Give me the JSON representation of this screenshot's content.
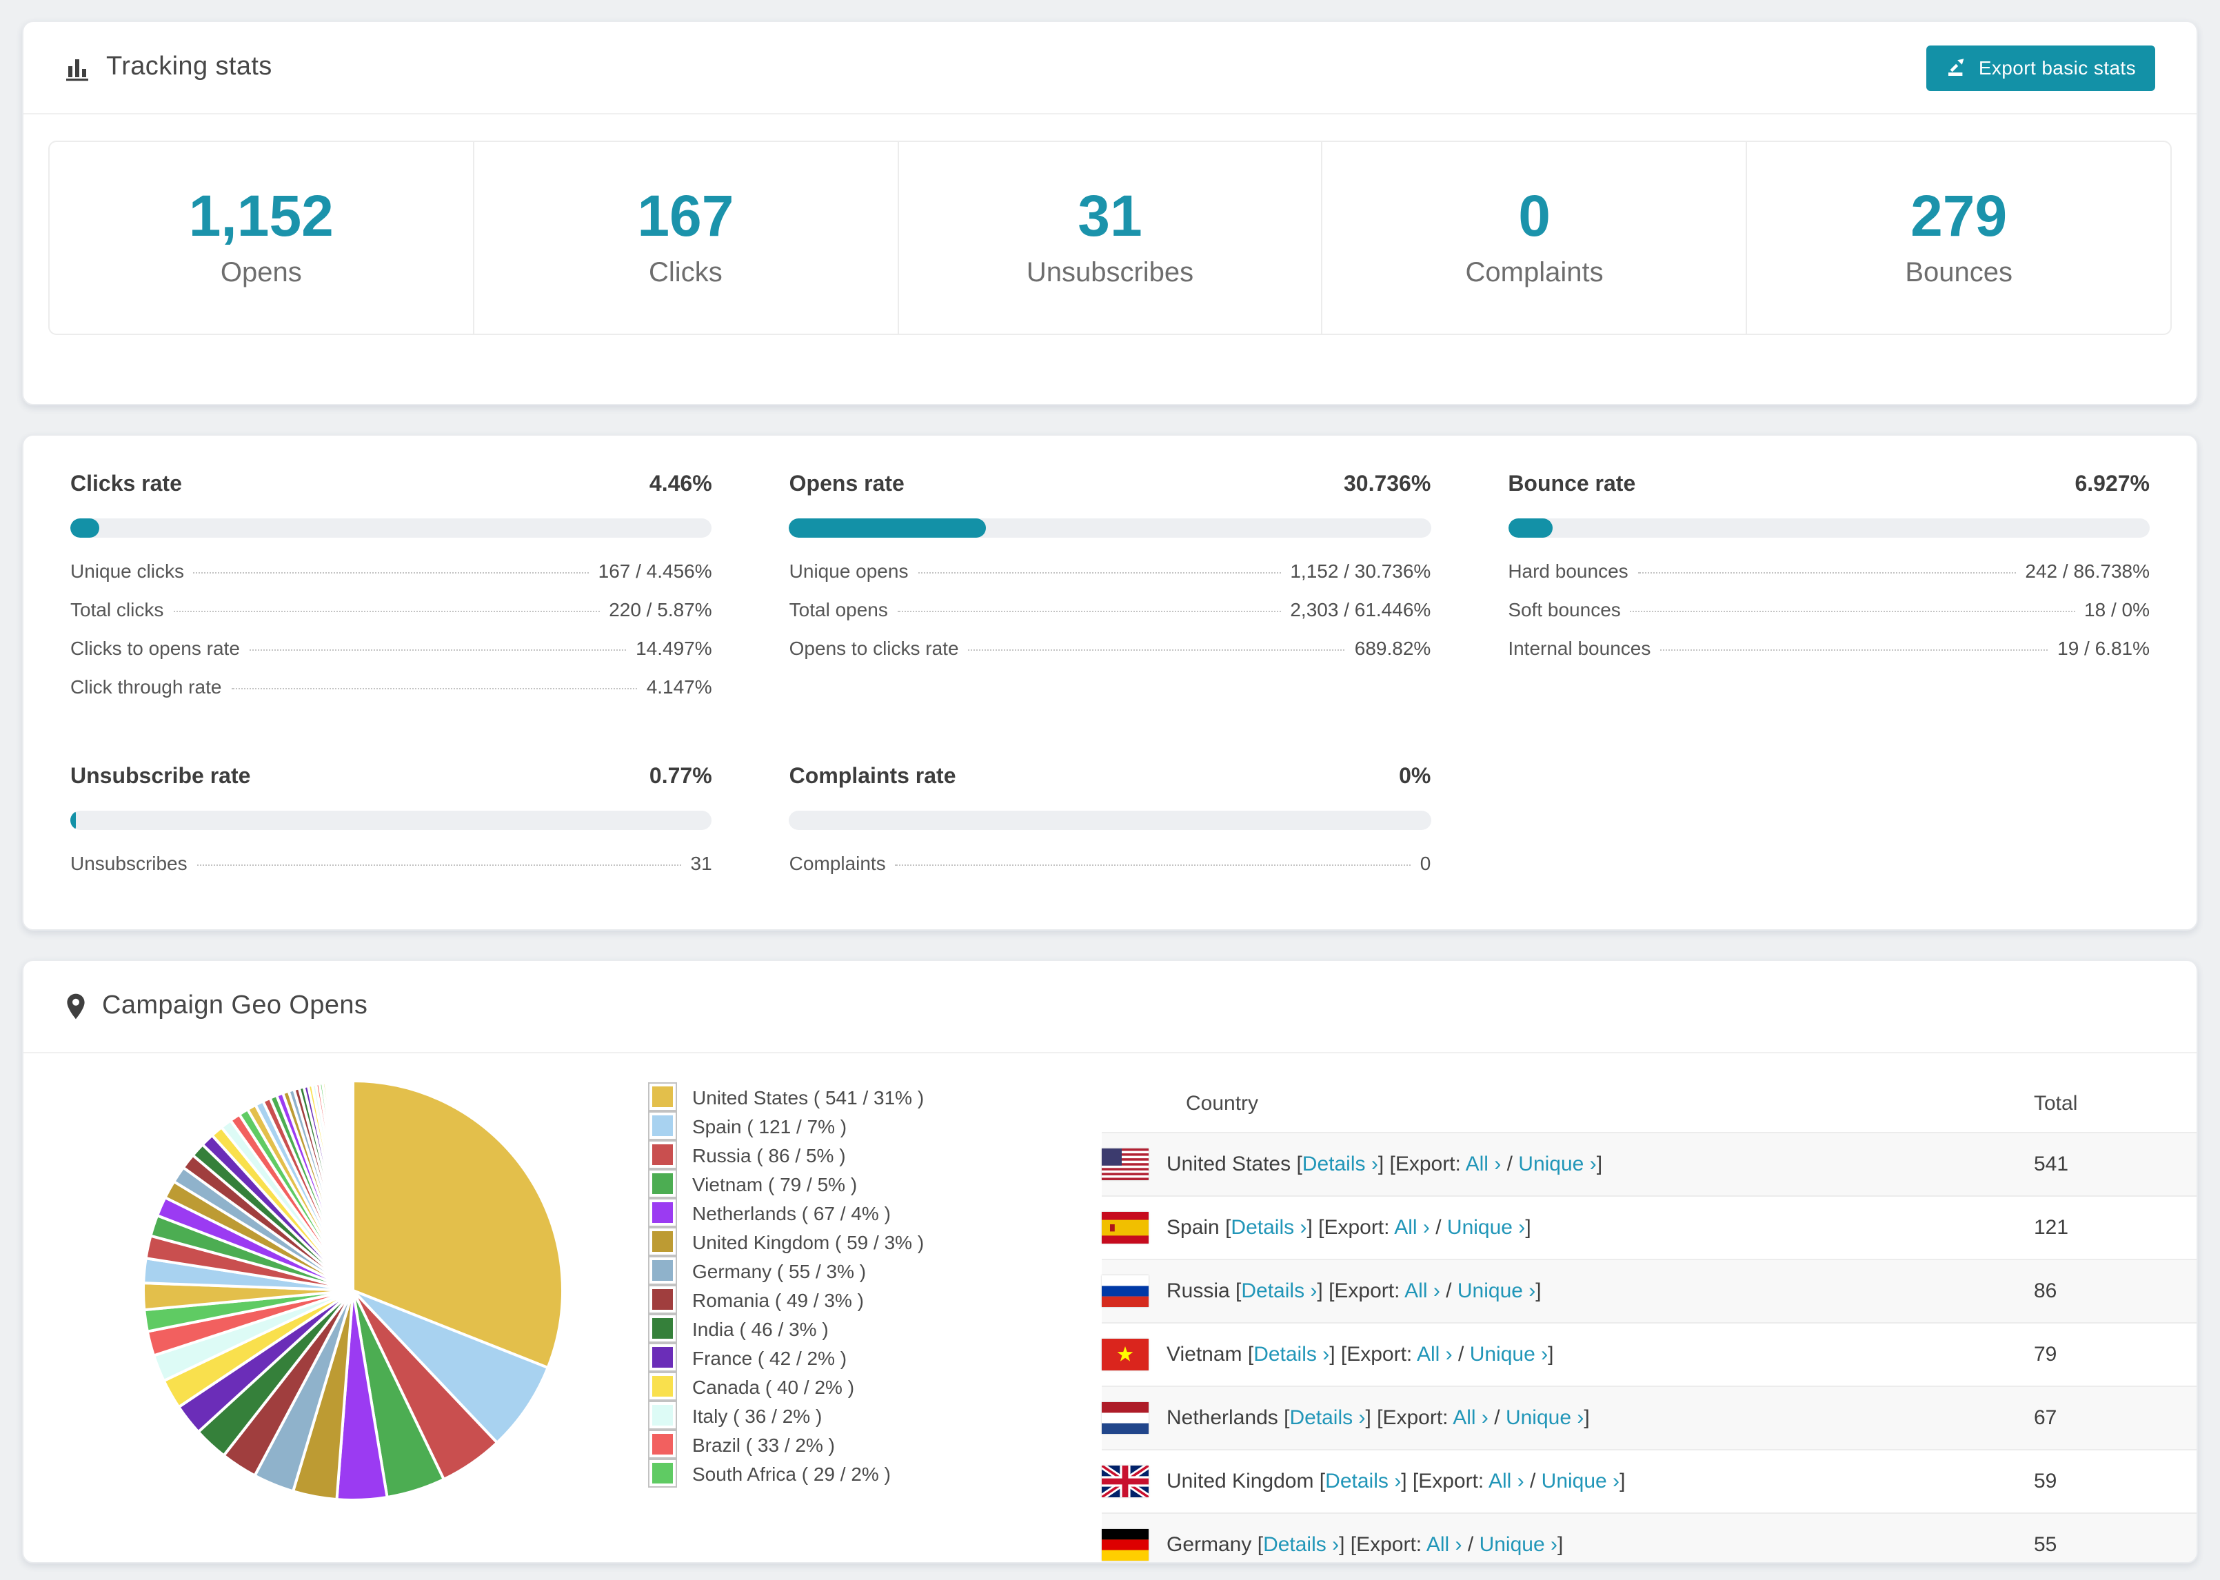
{
  "accent_color": "#1391a7",
  "link_color": "#2196b8",
  "tracking": {
    "title": "Tracking stats",
    "export_label": "Export basic stats",
    "summary": [
      {
        "value": "1,152",
        "label": "Opens"
      },
      {
        "value": "167",
        "label": "Clicks"
      },
      {
        "value": "31",
        "label": "Unsubscribes"
      },
      {
        "value": "0",
        "label": "Complaints"
      },
      {
        "value": "279",
        "label": "Bounces"
      }
    ]
  },
  "rates": [
    {
      "title": "Clicks rate",
      "percent": "4.46%",
      "bar": 4.46,
      "rows": [
        {
          "label": "Unique clicks",
          "value": "167 / 4.456%"
        },
        {
          "label": "Total clicks",
          "value": "220 / 5.87%"
        },
        {
          "label": "Clicks to opens rate",
          "value": "14.497%"
        },
        {
          "label": "Click through rate",
          "value": "4.147%"
        }
      ]
    },
    {
      "title": "Opens rate",
      "percent": "30.736%",
      "bar": 30.736,
      "rows": [
        {
          "label": "Unique opens",
          "value": "1,152 / 30.736%"
        },
        {
          "label": "Total opens",
          "value": "2,303 / 61.446%"
        },
        {
          "label": "Opens to clicks rate",
          "value": "689.82%"
        }
      ]
    },
    {
      "title": "Bounce rate",
      "percent": "6.927%",
      "bar": 6.927,
      "rows": [
        {
          "label": "Hard bounces",
          "value": "242 / 86.738%"
        },
        {
          "label": "Soft bounces",
          "value": "18 / 0%"
        },
        {
          "label": "Internal bounces",
          "value": "19 / 6.81%"
        }
      ]
    },
    {
      "title": "Unsubscribe rate",
      "percent": "0.77%",
      "bar": 0.77,
      "rows": [
        {
          "label": "Unsubscribes",
          "value": "31"
        }
      ]
    },
    {
      "title": "Complaints rate",
      "percent": "0%",
      "bar": 0,
      "rows": [
        {
          "label": "Complaints",
          "value": "0"
        }
      ]
    }
  ],
  "geo": {
    "title": "Campaign Geo Opens",
    "chart_data": {
      "type": "pie",
      "title": "Campaign Geo Opens",
      "labels": [
        "United States",
        "Spain",
        "Russia",
        "Vietnam",
        "Netherlands",
        "United Kingdom",
        "Germany",
        "Romania",
        "India",
        "France",
        "Canada",
        "Italy",
        "Brazil",
        "South Africa"
      ],
      "values": [
        541,
        121,
        86,
        79,
        67,
        59,
        55,
        49,
        46,
        42,
        40,
        36,
        33,
        29
      ],
      "percents": [
        "31%",
        "7%",
        "5%",
        "5%",
        "4%",
        "3%",
        "3%",
        "3%",
        "3%",
        "2%",
        "2%",
        "2%",
        "2%",
        "2%"
      ],
      "others": {
        "total": 462,
        "count": 46
      },
      "colors": [
        "#E3BF4B",
        "#A8D2F0",
        "#C94F4F",
        "#4CAD52",
        "#9B3BF2",
        "#BD9B33",
        "#8FB2CB",
        "#A03E3E",
        "#35803A",
        "#6B2DB8",
        "#F9E04D",
        "#DDFBF6",
        "#F2605F",
        "#5FCB63"
      ],
      "start_angle_deg": -90,
      "direction": "clockwise",
      "legend_position": "right"
    },
    "legend": [
      {
        "name": "United States",
        "value": "541",
        "pct": "31%"
      },
      {
        "name": "Spain",
        "value": "121",
        "pct": "7%"
      },
      {
        "name": "Russia",
        "value": "86",
        "pct": "5%"
      },
      {
        "name": "Vietnam",
        "value": "79",
        "pct": "5%"
      },
      {
        "name": "Netherlands",
        "value": "67",
        "pct": "4%"
      },
      {
        "name": "United Kingdom",
        "value": "59",
        "pct": "3%"
      },
      {
        "name": "Germany",
        "value": "55",
        "pct": "3%"
      },
      {
        "name": "Romania",
        "value": "49",
        "pct": "3%"
      },
      {
        "name": "India",
        "value": "46",
        "pct": "3%"
      },
      {
        "name": "France",
        "value": "42",
        "pct": "2%"
      },
      {
        "name": "Canada",
        "value": "40",
        "pct": "2%"
      },
      {
        "name": "Italy",
        "value": "36",
        "pct": "2%"
      },
      {
        "name": "Brazil",
        "value": "33",
        "pct": "2%"
      },
      {
        "name": "South Africa",
        "value": "29",
        "pct": "2%"
      }
    ],
    "table": {
      "columns": [
        "Country",
        "Total"
      ],
      "links": {
        "details": "Details ›",
        "export_prefix": "[Export:",
        "all": "All ›",
        "slash": " / ",
        "unique": "Unique ›"
      },
      "rows": [
        {
          "country": "United States",
          "total": "541",
          "flag": "us"
        },
        {
          "country": "Spain",
          "total": "121",
          "flag": "es"
        },
        {
          "country": "Russia",
          "total": "86",
          "flag": "ru"
        },
        {
          "country": "Vietnam",
          "total": "79",
          "flag": "vn"
        },
        {
          "country": "Netherlands",
          "total": "67",
          "flag": "nl"
        },
        {
          "country": "United Kingdom",
          "total": "59",
          "flag": "gb"
        },
        {
          "country": "Germany",
          "total": "55",
          "flag": "de"
        }
      ]
    }
  }
}
